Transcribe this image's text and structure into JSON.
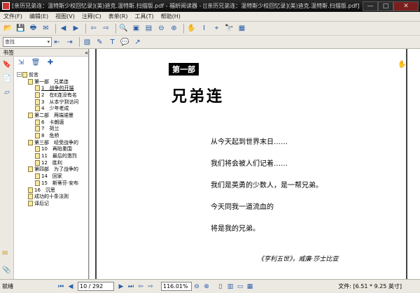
{
  "window": {
    "title": "[亲历兄弟连：温特斯少校回忆录](美)迪克.温特斯.扫描版.pdf - 福昕阅读器 - [[亲历兄弟连：温特斯少校回忆录](美)迪克.温特斯.扫描版.pdf]",
    "minimize": "—",
    "maximize": "□",
    "close": "✕"
  },
  "menu": [
    "文件(F)",
    "编辑(E)",
    "视图(V)",
    "注释(C)",
    "表单(R)",
    "工具(T)",
    "帮助(H)"
  ],
  "toolbar": {
    "search_placeholder": "查找",
    "icons": [
      "open-icon",
      "save-icon",
      "print-icon",
      "email-icon",
      "back-icon",
      "forward-icon",
      "prev-view-icon",
      "next-view-icon",
      "zoom-in-icon",
      "fit-page-icon",
      "fit-width-icon",
      "zoom-out-icon",
      "zoom-plus-icon",
      "hand-icon",
      "text-select-icon",
      "snapshot-icon",
      "find-icon",
      "typewriter-icon"
    ]
  },
  "sidebar": {
    "header": "书签",
    "collapse": "«",
    "tree": [
      {
        "label": "前言",
        "level": 0,
        "expandable": true
      },
      {
        "label": "第一部　兄弟连",
        "level": 1,
        "expandable": false
      },
      {
        "label": "1　战争的开端",
        "level": 2,
        "selected": true
      },
      {
        "label": "2　在E连没有名",
        "level": 2
      },
      {
        "label": "3　从本宁到访问",
        "level": 2
      },
      {
        "label": "4　少年老成",
        "level": 2
      },
      {
        "label": "第二部　两端诺曼",
        "level": 1
      },
      {
        "label": "6　卡朗唐",
        "level": 2
      },
      {
        "label": "7　荷兰",
        "level": 2
      },
      {
        "label": "8　危桥",
        "level": 2
      },
      {
        "label": "第三部　经受战争的",
        "level": 1
      },
      {
        "label": "10　再陷重围",
        "level": 2
      },
      {
        "label": "11　最后的激烈",
        "level": 2
      },
      {
        "label": "12　胜利",
        "level": 2
      },
      {
        "label": "第四部　为了战争的",
        "level": 1
      },
      {
        "label": "14　回家",
        "level": 2
      },
      {
        "label": "15　斯蒂芬·安布",
        "level": 2
      },
      {
        "label": "16　沉思",
        "level": 1
      },
      {
        "label": "成功的十条法则",
        "level": 1
      },
      {
        "label": "译后记",
        "level": 1
      }
    ]
  },
  "document": {
    "part_label": "第一部",
    "chapter_title": "兄弟连",
    "poem_lines": [
      "从今天起到世界末日……",
      "我们将会被人们记着……",
      "我们是英勇的少数人，是一帮兄弟。",
      "今天同我一道流血的",
      "将是我的兄弟。"
    ],
    "attribution": "《亨利五世》，威廉·莎士比亚"
  },
  "status": {
    "ready": "就绪",
    "page": "10 / 292",
    "zoom": "116.01%",
    "file_info": "文件: [6.51 * 9.25 英寸]"
  }
}
